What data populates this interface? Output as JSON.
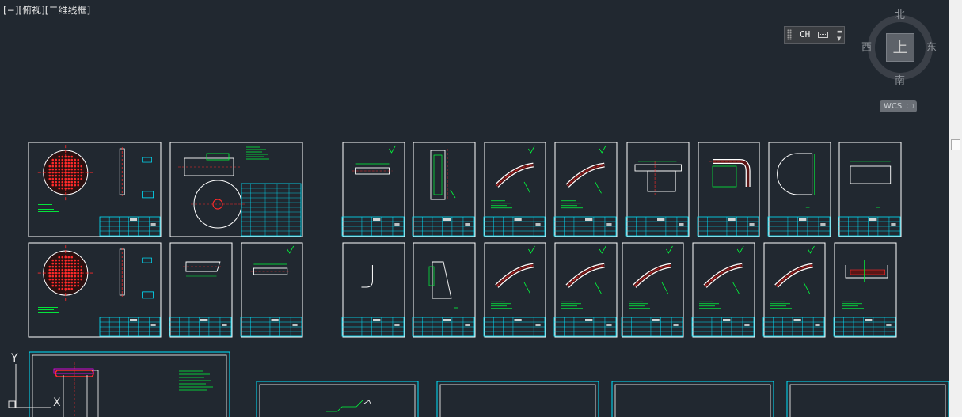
{
  "viewport_label": {
    "minus": "[−]",
    "view": "[俯视]",
    "style": "[二维线框]"
  },
  "ime_bar": {
    "text": "CH",
    "keyboard_icon": "keyboard-icon"
  },
  "viewcube": {
    "north": "北",
    "south": "南",
    "east": "东",
    "west": "西",
    "face": "上",
    "wcs_label": "WCS"
  },
  "ucs_icon": {
    "y_label": "Y",
    "x_label": "X"
  },
  "colors": {
    "background": "#212830",
    "sheet_border": "#ffffff",
    "title_block": "#00e5ff",
    "geometry": "#00ff3c",
    "hatch": "#ff2a2a",
    "text_annotations": "#00ff3c"
  },
  "drawing_sheets": [
    {
      "row": 1,
      "content": "flange-plate"
    },
    {
      "row": 1,
      "content": "tank-assembly"
    },
    {
      "row": 1,
      "content": "straight-bar"
    },
    {
      "row": 1,
      "content": "u-channel"
    },
    {
      "row": 1,
      "content": "bent-pipe"
    },
    {
      "row": 1,
      "content": "bent-pipe"
    },
    {
      "row": 1,
      "content": "bracket"
    },
    {
      "row": 1,
      "content": "hook-pipe"
    },
    {
      "row": 1,
      "content": "half-circle"
    },
    {
      "row": 1,
      "content": "rectangle-plate"
    },
    {
      "row": 2,
      "content": "flange-plate"
    },
    {
      "row": 2,
      "content": "tube-section"
    },
    {
      "row": 2,
      "content": "straight-bar"
    },
    {
      "row": 2,
      "content": "small-hook"
    },
    {
      "row": 2,
      "content": "taper-plate"
    },
    {
      "row": 2,
      "content": "bent-pipe"
    },
    {
      "row": 2,
      "content": "bent-pipe"
    },
    {
      "row": 2,
      "content": "bent-pipe"
    },
    {
      "row": 2,
      "content": "bent-pipe"
    },
    {
      "row": 2,
      "content": "bent-pipe"
    },
    {
      "row": 2,
      "content": "channel-section"
    }
  ]
}
